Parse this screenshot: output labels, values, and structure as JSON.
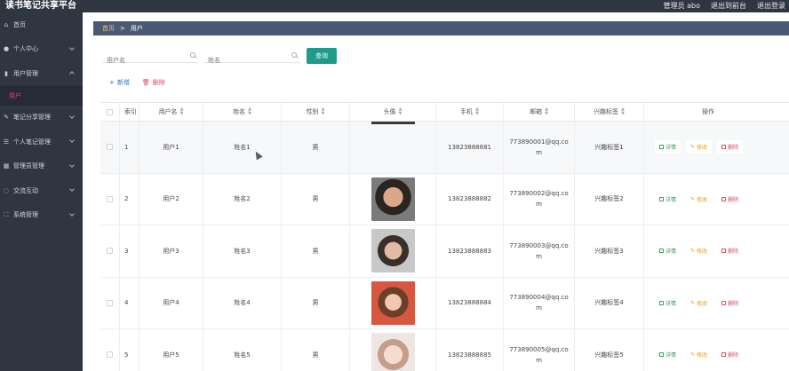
{
  "app": {
    "title": "读书笔记共享平台",
    "admin_label": "管理员 abo",
    "back_front": "退出到前台",
    "logout": "退出登录"
  },
  "sidebar": {
    "items": [
      {
        "label": "首页",
        "icon": "home-icon"
      },
      {
        "label": "个人中心",
        "icon": "user-icon"
      },
      {
        "label": "用户管理",
        "icon": "chart-icon",
        "expanded": true
      },
      {
        "label": "笔记分享管理",
        "icon": "edit-icon"
      },
      {
        "label": "个人笔记管理",
        "icon": "list-icon"
      },
      {
        "label": "管理员管理",
        "icon": "grid-icon"
      },
      {
        "label": "交流互动",
        "icon": "chat-icon"
      },
      {
        "label": "系统管理",
        "icon": "expand-icon"
      }
    ],
    "sub_item": "用户"
  },
  "breadcrumb": {
    "home": "首页",
    "sep": ">",
    "current": "用户"
  },
  "search": {
    "username_placeholder": "用户名",
    "name_placeholder": "姓名",
    "query_label": "查询"
  },
  "actions": {
    "add_label": "新增",
    "delete_label": "删除"
  },
  "table": {
    "headers": {
      "index": "索引",
      "username": "用户名",
      "name": "姓名",
      "gender": "性别",
      "avatar": "头像",
      "phone": "手机",
      "email": "邮箱",
      "tag": "兴趣标签",
      "ops": "操作"
    },
    "op_labels": {
      "detail": "详情",
      "edit": "修改",
      "delete": "删除"
    },
    "rows": [
      {
        "index": "1",
        "username": "用户1",
        "name": "姓名1",
        "gender": "男",
        "phone": "13823888881",
        "email": "773890001@qq.com",
        "tag": "兴趣标签1"
      },
      {
        "index": "2",
        "username": "用户2",
        "name": "姓名2",
        "gender": "男",
        "phone": "13823888882",
        "email": "773890002@qq.com",
        "tag": "兴趣标签2"
      },
      {
        "index": "3",
        "username": "用户3",
        "name": "姓名3",
        "gender": "男",
        "phone": "13823888883",
        "email": "773890003@qq.com",
        "tag": "兴趣标签3"
      },
      {
        "index": "4",
        "username": "用户4",
        "name": "姓名4",
        "gender": "男",
        "phone": "13823888884",
        "email": "773890004@qq.com",
        "tag": "兴趣标签4"
      },
      {
        "index": "5",
        "username": "用户5",
        "name": "姓名5",
        "gender": "男",
        "phone": "13823888885",
        "email": "773890005@qq.com",
        "tag": "兴趣标签5"
      }
    ]
  },
  "colors": {
    "sidebar_bg": "#2f3541",
    "breadcrumb_bg": "#4a5a75",
    "query_button": "#1e9b8a",
    "active_sub": "#e6447a"
  }
}
